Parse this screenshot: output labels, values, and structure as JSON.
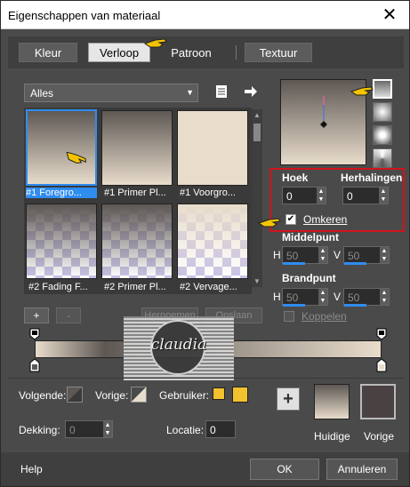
{
  "window": {
    "title": "Eigenschappen van materiaal",
    "close": "✕"
  },
  "tabs": [
    {
      "label": "Kleur"
    },
    {
      "label": "Verloop",
      "active": true
    },
    {
      "label": "Patroon"
    },
    {
      "label": "Textuur"
    }
  ],
  "gallery": {
    "filter": "Alles",
    "items": [
      {
        "label": "#1 Foregro...",
        "selected": true,
        "style": "fg"
      },
      {
        "label": "#1 Primer Pl...",
        "style": "primer"
      },
      {
        "label": "#1 Voorgro...",
        "style": "beige"
      },
      {
        "label": "#2 Fading F...",
        "style": "fade"
      },
      {
        "label": "#2 Primer Pl...",
        "style": "fade"
      },
      {
        "label": "#2 Vervage...",
        "style": "fade"
      }
    ],
    "add": "+",
    "remove": "-",
    "btn_hidden_1": "Hernoemen",
    "btn_hidden_2": "Opslaan"
  },
  "settings": {
    "hoek_label": "Hoek",
    "hoek_value": "0",
    "herhalingen_label": "Herhalingen",
    "herhalingen_value": "0",
    "omkeren_label": "Omkeren",
    "omkeren_checked": true,
    "middelpunt_label": "Middelpunt",
    "brandpunt_label": "Brandpunt",
    "h_label": "H",
    "v_label": "V",
    "mid_h": "50",
    "mid_v": "50",
    "brand_h": "50",
    "brand_v": "50",
    "koppelen_label": "Koppelen"
  },
  "bottom": {
    "volgende_label": "Volgende:",
    "vorige_label": "Vorige:",
    "gebruiker_label": "Gebruiker:",
    "dekking_label": "Dekking:",
    "dekking_value": "0",
    "locatie_label": "Locatie:",
    "locatie_value": "0",
    "huidige_label": "Huidige",
    "vorige_label2": "Vorige",
    "add_button": "+"
  },
  "footer": {
    "help": "Help",
    "ok": "OK",
    "annuleren": "Annuleren"
  },
  "watermark": {
    "text": "claudia"
  },
  "colors": {
    "gradient_top": "#5e5854",
    "gradient_bottom": "#e8dccb",
    "accent": "#2f8cf0",
    "highlight_box": "#d0141c",
    "user_swatch": "#f2c12e",
    "previous_swatch": "#4a4242"
  }
}
